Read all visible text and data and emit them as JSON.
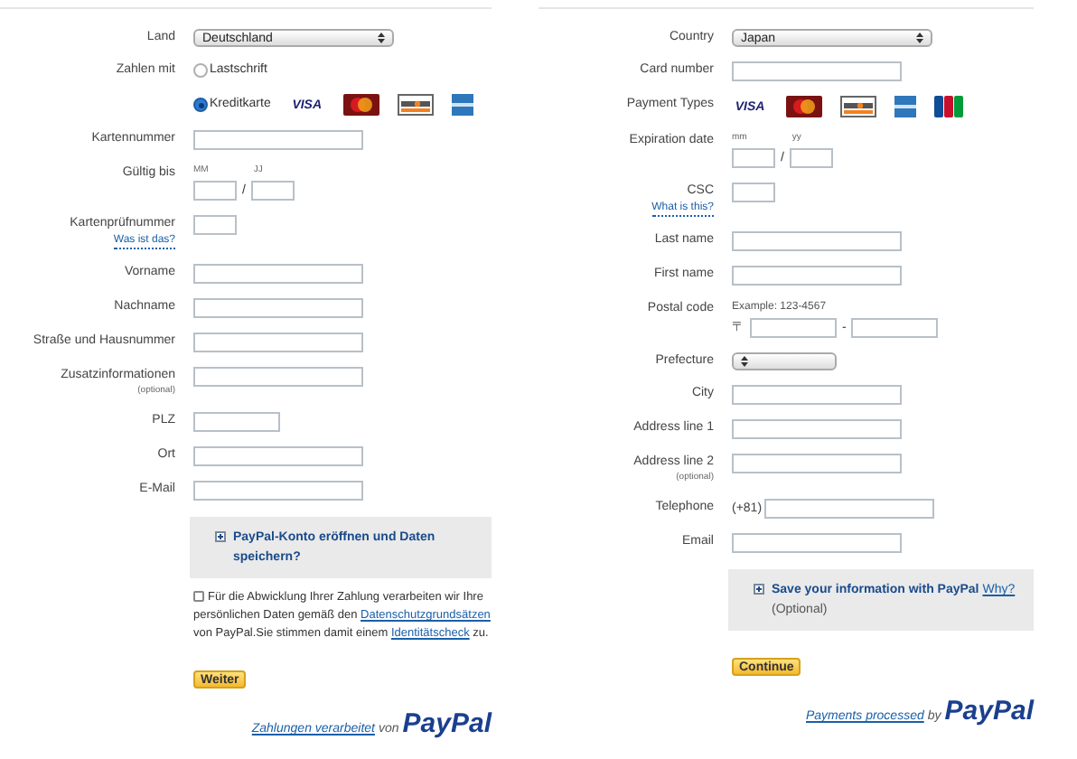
{
  "left": {
    "rows": [
      {
        "kind": "select",
        "label": "Land",
        "value": "Deutschland"
      },
      {
        "kind": "radio",
        "label": "Zahlen mit",
        "option": "Lastschrift",
        "selected": false
      },
      {
        "kind": "radio",
        "option": "Kreditkarte",
        "selected": true,
        "cards": [
          {
            "kind": "visa",
            "text": "VISA"
          },
          {
            "kind": "mastercard"
          },
          {
            "kind": "discover"
          },
          {
            "kind": "amex"
          }
        ]
      },
      {
        "kind": "input",
        "label": "Kartennummer"
      },
      {
        "kind": "expiry",
        "label": "Gültig bis",
        "month": "MM",
        "year": "JJ",
        "separator": "/"
      },
      {
        "kind": "code",
        "label": "Kartenprüfnummer",
        "link": "Was ist das?"
      },
      {
        "kind": "input",
        "label": "Vorname"
      },
      {
        "kind": "input",
        "label": "Nachname"
      },
      {
        "kind": "input",
        "label": "Straße und Hausnummer"
      },
      {
        "kind": "input",
        "label": "Zusatzinformationen",
        "note": "(optional)"
      },
      {
        "kind": "short_input",
        "label": "PLZ"
      },
      {
        "kind": "input",
        "label": "Ort"
      },
      {
        "kind": "input",
        "label": "E-Mail"
      }
    ],
    "save_box": {
      "text": "PayPal-Konto eröffnen und Daten speichern?"
    },
    "consent": {
      "checked": false,
      "parts": [
        {
          "kind": "text",
          "text": "Für die Abwicklung Ihrer Zahlung verarbeiten wir Ihre persönlichen Daten gemäß den "
        },
        {
          "kind": "link",
          "text": "Datenschutzgrundsätzen"
        },
        {
          "kind": "text",
          "text": " von PayPal.Sie stimmen damit einem "
        },
        {
          "kind": "link",
          "text": "Identitätscheck"
        },
        {
          "kind": "text",
          "text": " zu."
        }
      ]
    },
    "button": "Weiter",
    "footer": {
      "link": "Zahlungen verarbeitet",
      "text": "von",
      "logo": "PayPal"
    }
  },
  "right": {
    "rows": [
      {
        "kind": "select",
        "label": "Country",
        "value": "Japan"
      },
      {
        "kind": "input",
        "label": "Card number"
      },
      {
        "kind": "cards",
        "label": "Payment Types",
        "cards": [
          {
            "kind": "visa",
            "text": "VISA"
          },
          {
            "kind": "mastercard"
          },
          {
            "kind": "discover"
          },
          {
            "kind": "amex"
          },
          {
            "kind": "jcb"
          }
        ]
      },
      {
        "kind": "expiry",
        "label": "Expiration date",
        "month": "mm",
        "year": "yy",
        "separator": "/"
      },
      {
        "kind": "code",
        "label": "CSC",
        "link": "What is this?"
      },
      {
        "kind": "input",
        "label": "Last name"
      },
      {
        "kind": "input",
        "label": "First name"
      },
      {
        "kind": "postal",
        "label": "Postal code",
        "hint": "Example: 123-4567",
        "prefix": "〒",
        "separator": "-"
      },
      {
        "kind": "short_select",
        "label": "Prefecture"
      },
      {
        "kind": "input",
        "label": "City"
      },
      {
        "kind": "input",
        "label": "Address line 1"
      },
      {
        "kind": "input",
        "label": "Address line 2",
        "note": "(optional)"
      },
      {
        "kind": "phone",
        "label": "Telephone",
        "prefix": "(+81)"
      },
      {
        "kind": "input",
        "label": "Email"
      }
    ],
    "save_box": {
      "text": "Save your information with PayPal",
      "link": "Why?",
      "note": "(Optional)"
    },
    "button": "Continue",
    "footer": {
      "link": "Payments processed",
      "text": "by",
      "logo": "PayPal"
    }
  }
}
